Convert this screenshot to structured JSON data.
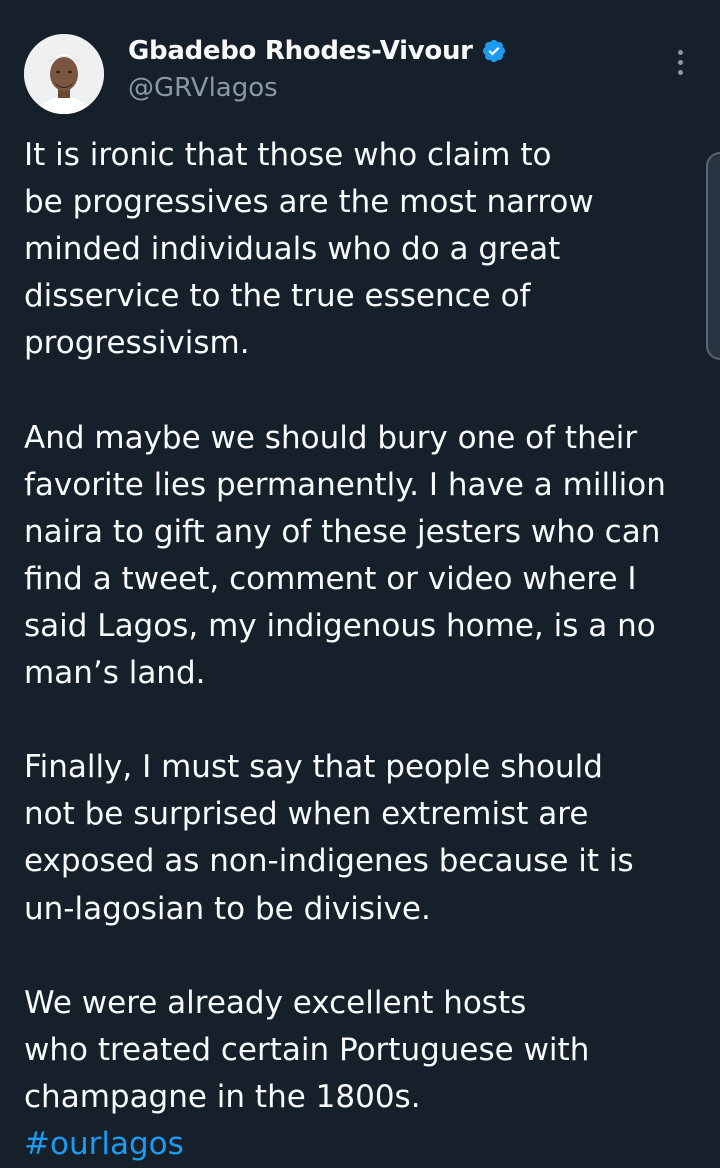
{
  "author": {
    "display_name": "Gbadebo Rhodes-Vivour",
    "handle": "@GRVlagos",
    "verified": true
  },
  "icons": {
    "verified": "verified-badge-icon",
    "more": "more-options-icon"
  },
  "colors": {
    "background": "#15202b",
    "text": "#f7f9f9",
    "secondary_text": "#8b98a5",
    "link": "#1d9bf0",
    "verified_badge": "#1d9bf0"
  },
  "tweet": {
    "lines": [
      "It is ironic that those who claim to",
      "be progressives are the most narrow",
      "minded individuals who do a great",
      "disservice to the true essence of",
      "progressivism.",
      "",
      "And maybe we should bury one of their",
      "favorite lies permanently. I have a million",
      "naira to gift any of these jesters who can",
      "find a tweet, comment or video where I",
      "said Lagos, my indigenous home, is a no",
      "man’s land.",
      "",
      "Finally, I must say that people should",
      "not be surprised when extremist are",
      "exposed as non-indigenes because it is",
      "un-lagosian to be divisive.",
      "",
      "We were already excellent hosts",
      "who treated certain Portuguese with",
      "champagne in the 1800s."
    ],
    "hashtag": "#ourlagos"
  }
}
